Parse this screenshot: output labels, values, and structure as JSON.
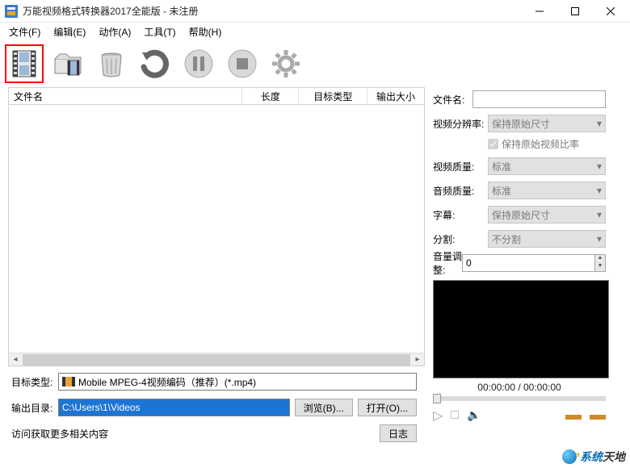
{
  "titlebar": {
    "title": "万能视频格式转换器2017全能版 - 未注册"
  },
  "menubar": {
    "file": "文件(F)",
    "edit": "编辑(E)",
    "action": "动作(A)",
    "tool": "工具(T)",
    "help": "帮助(H)"
  },
  "columns": {
    "name": "文件名",
    "length": "长度",
    "target": "目标类型",
    "size": "输出大小"
  },
  "sidepanel": {
    "filename_label": "文件名:",
    "filename_value": "",
    "res_label": "视频分辨率:",
    "res_value": "保持原始尺寸",
    "keep_ratio_label": "保持原始视频比率",
    "vq_label": "视频质量:",
    "vq_value": "标准",
    "aq_label": "音频质量:",
    "aq_value": "标准",
    "sub_label": "字幕:",
    "sub_value": "保持原始尺寸",
    "split_label": "分割:",
    "split_value": "不分割",
    "vol_label": "音量调整:",
    "vol_value": "0"
  },
  "preview": {
    "time": "00:00:00 / 00:00:00"
  },
  "bottom": {
    "target_label": "目标类型:",
    "target_value": "Mobile MPEG-4视频编码（推荐）(*.mp4)",
    "output_label": "输出目录:",
    "output_value": "C:\\Users\\1\\Videos",
    "browse": "浏览(B)...",
    "open": "打开(O)...",
    "log": "日志",
    "link": "访问获取更多相关内容"
  },
  "watermark": {
    "a": "系统",
    "b": "天地"
  }
}
